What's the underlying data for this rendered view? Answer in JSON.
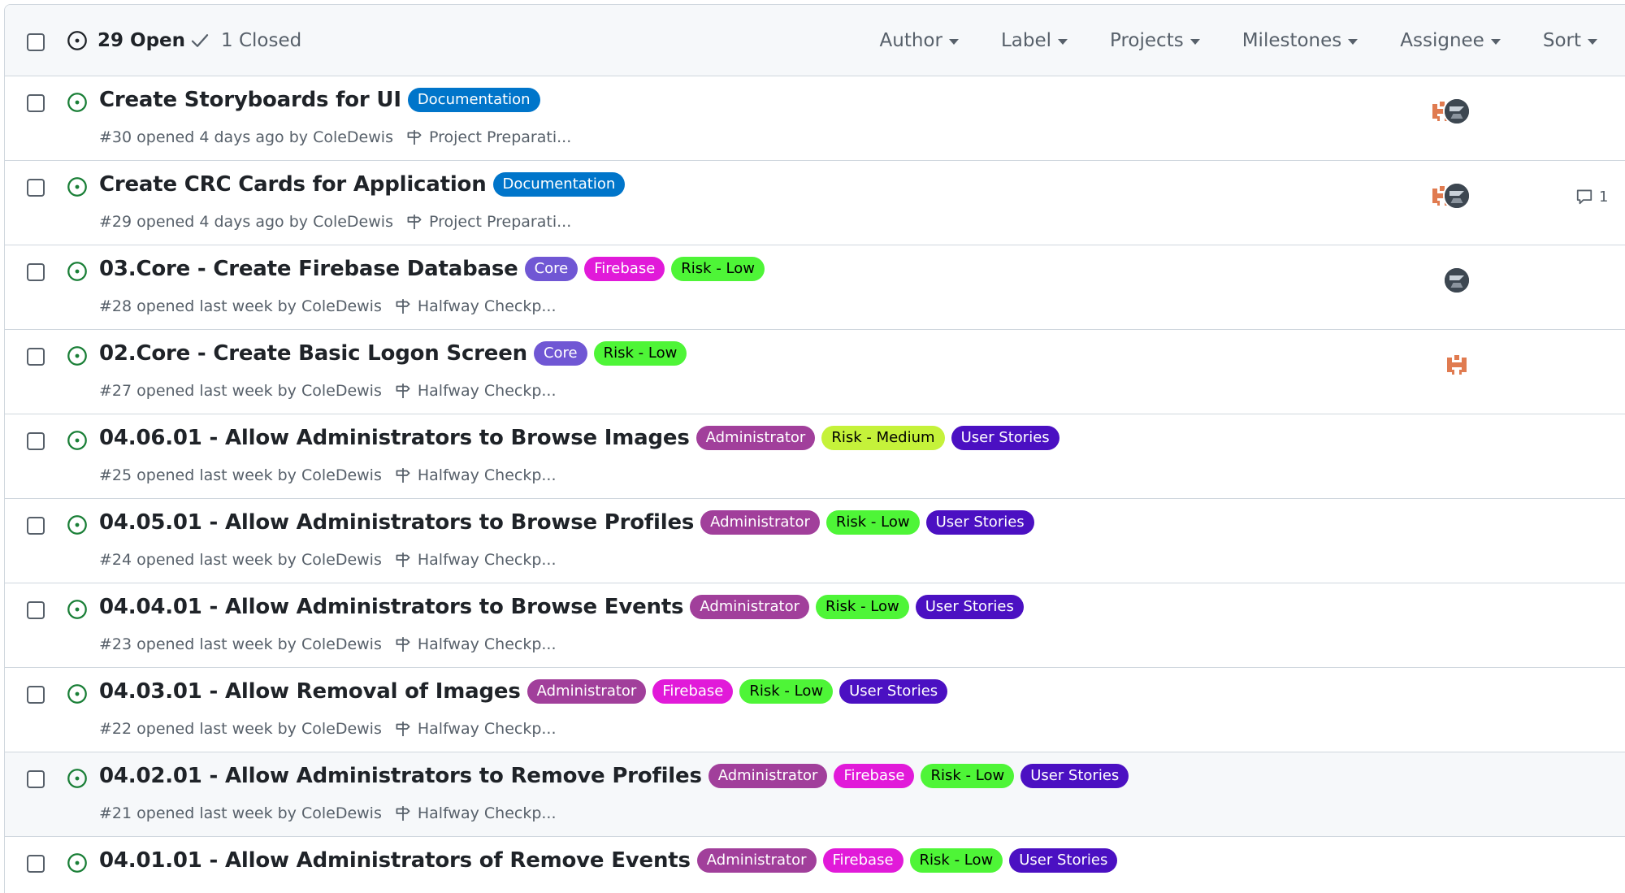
{
  "header": {
    "open_count": "29 Open",
    "closed_count": "1 Closed",
    "filters": [
      "Author",
      "Label",
      "Projects",
      "Milestones",
      "Assignee",
      "Sort"
    ]
  },
  "colors": {
    "open_green": "#1a7f37",
    "Documentation": "#0075ca",
    "Core": "#7057d4",
    "Firebase": "#e11ad9",
    "Risk - Low": "#4ef537",
    "Risk - Medium": "#c5f23a",
    "Administrator": "#a13f9b",
    "User Stories": "#4b10c2"
  },
  "issues": [
    {
      "title": "Create Storyboards for UI",
      "labels": [
        "Documentation"
      ],
      "meta": "#30 opened 4 days ago by ColeDewis",
      "milestone": "Project Preparati...",
      "assignees": [
        "orange",
        "dark"
      ],
      "comments": ""
    },
    {
      "title": "Create CRC Cards for Application",
      "labels": [
        "Documentation"
      ],
      "meta": "#29 opened 4 days ago by ColeDewis",
      "milestone": "Project Preparati...",
      "assignees": [
        "orange",
        "dark"
      ],
      "comments": "1"
    },
    {
      "title": "03.Core - Create Firebase Database",
      "labels": [
        "Core",
        "Firebase",
        "Risk - Low"
      ],
      "meta": "#28 opened last week by ColeDewis",
      "milestone": "Halfway Checkp...",
      "assignees": [
        "dark"
      ],
      "comments": ""
    },
    {
      "title": "02.Core - Create Basic Logon Screen",
      "labels": [
        "Core",
        "Risk - Low"
      ],
      "meta": "#27 opened last week by ColeDewis",
      "milestone": "Halfway Checkp...",
      "assignees": [
        "orange"
      ],
      "comments": ""
    },
    {
      "title": "04.06.01 - Allow Administrators to Browse Images",
      "labels": [
        "Administrator",
        "Risk - Medium",
        "User Stories"
      ],
      "meta": "#25 opened last week by ColeDewis",
      "milestone": "Halfway Checkp...",
      "assignees": [],
      "comments": ""
    },
    {
      "title": "04.05.01 - Allow Administrators to Browse Profiles",
      "labels": [
        "Administrator",
        "Risk - Low",
        "User Stories"
      ],
      "meta": "#24 opened last week by ColeDewis",
      "milestone": "Halfway Checkp...",
      "assignees": [],
      "comments": ""
    },
    {
      "title": "04.04.01 - Allow Administrators to Browse Events",
      "labels": [
        "Administrator",
        "Risk - Low",
        "User Stories"
      ],
      "meta": "#23 opened last week by ColeDewis",
      "milestone": "Halfway Checkp...",
      "assignees": [],
      "comments": ""
    },
    {
      "title": "04.03.01 - Allow Removal of Images",
      "labels": [
        "Administrator",
        "Firebase",
        "Risk - Low",
        "User Stories"
      ],
      "meta": "#22 opened last week by ColeDewis",
      "milestone": "Halfway Checkp...",
      "assignees": [],
      "comments": ""
    },
    {
      "title": "04.02.01 - Allow Administrators to Remove Profiles",
      "labels": [
        "Administrator",
        "Firebase",
        "Risk - Low",
        "User Stories"
      ],
      "meta": "#21 opened last week by ColeDewis",
      "milestone": "Halfway Checkp...",
      "assignees": [],
      "comments": "",
      "highlight": true
    },
    {
      "title": "04.01.01 - Allow Administrators of Remove Events",
      "labels": [
        "Administrator",
        "Firebase",
        "Risk - Low",
        "User Stories"
      ],
      "meta": "",
      "milestone": "",
      "assignees": [],
      "comments": ""
    }
  ]
}
